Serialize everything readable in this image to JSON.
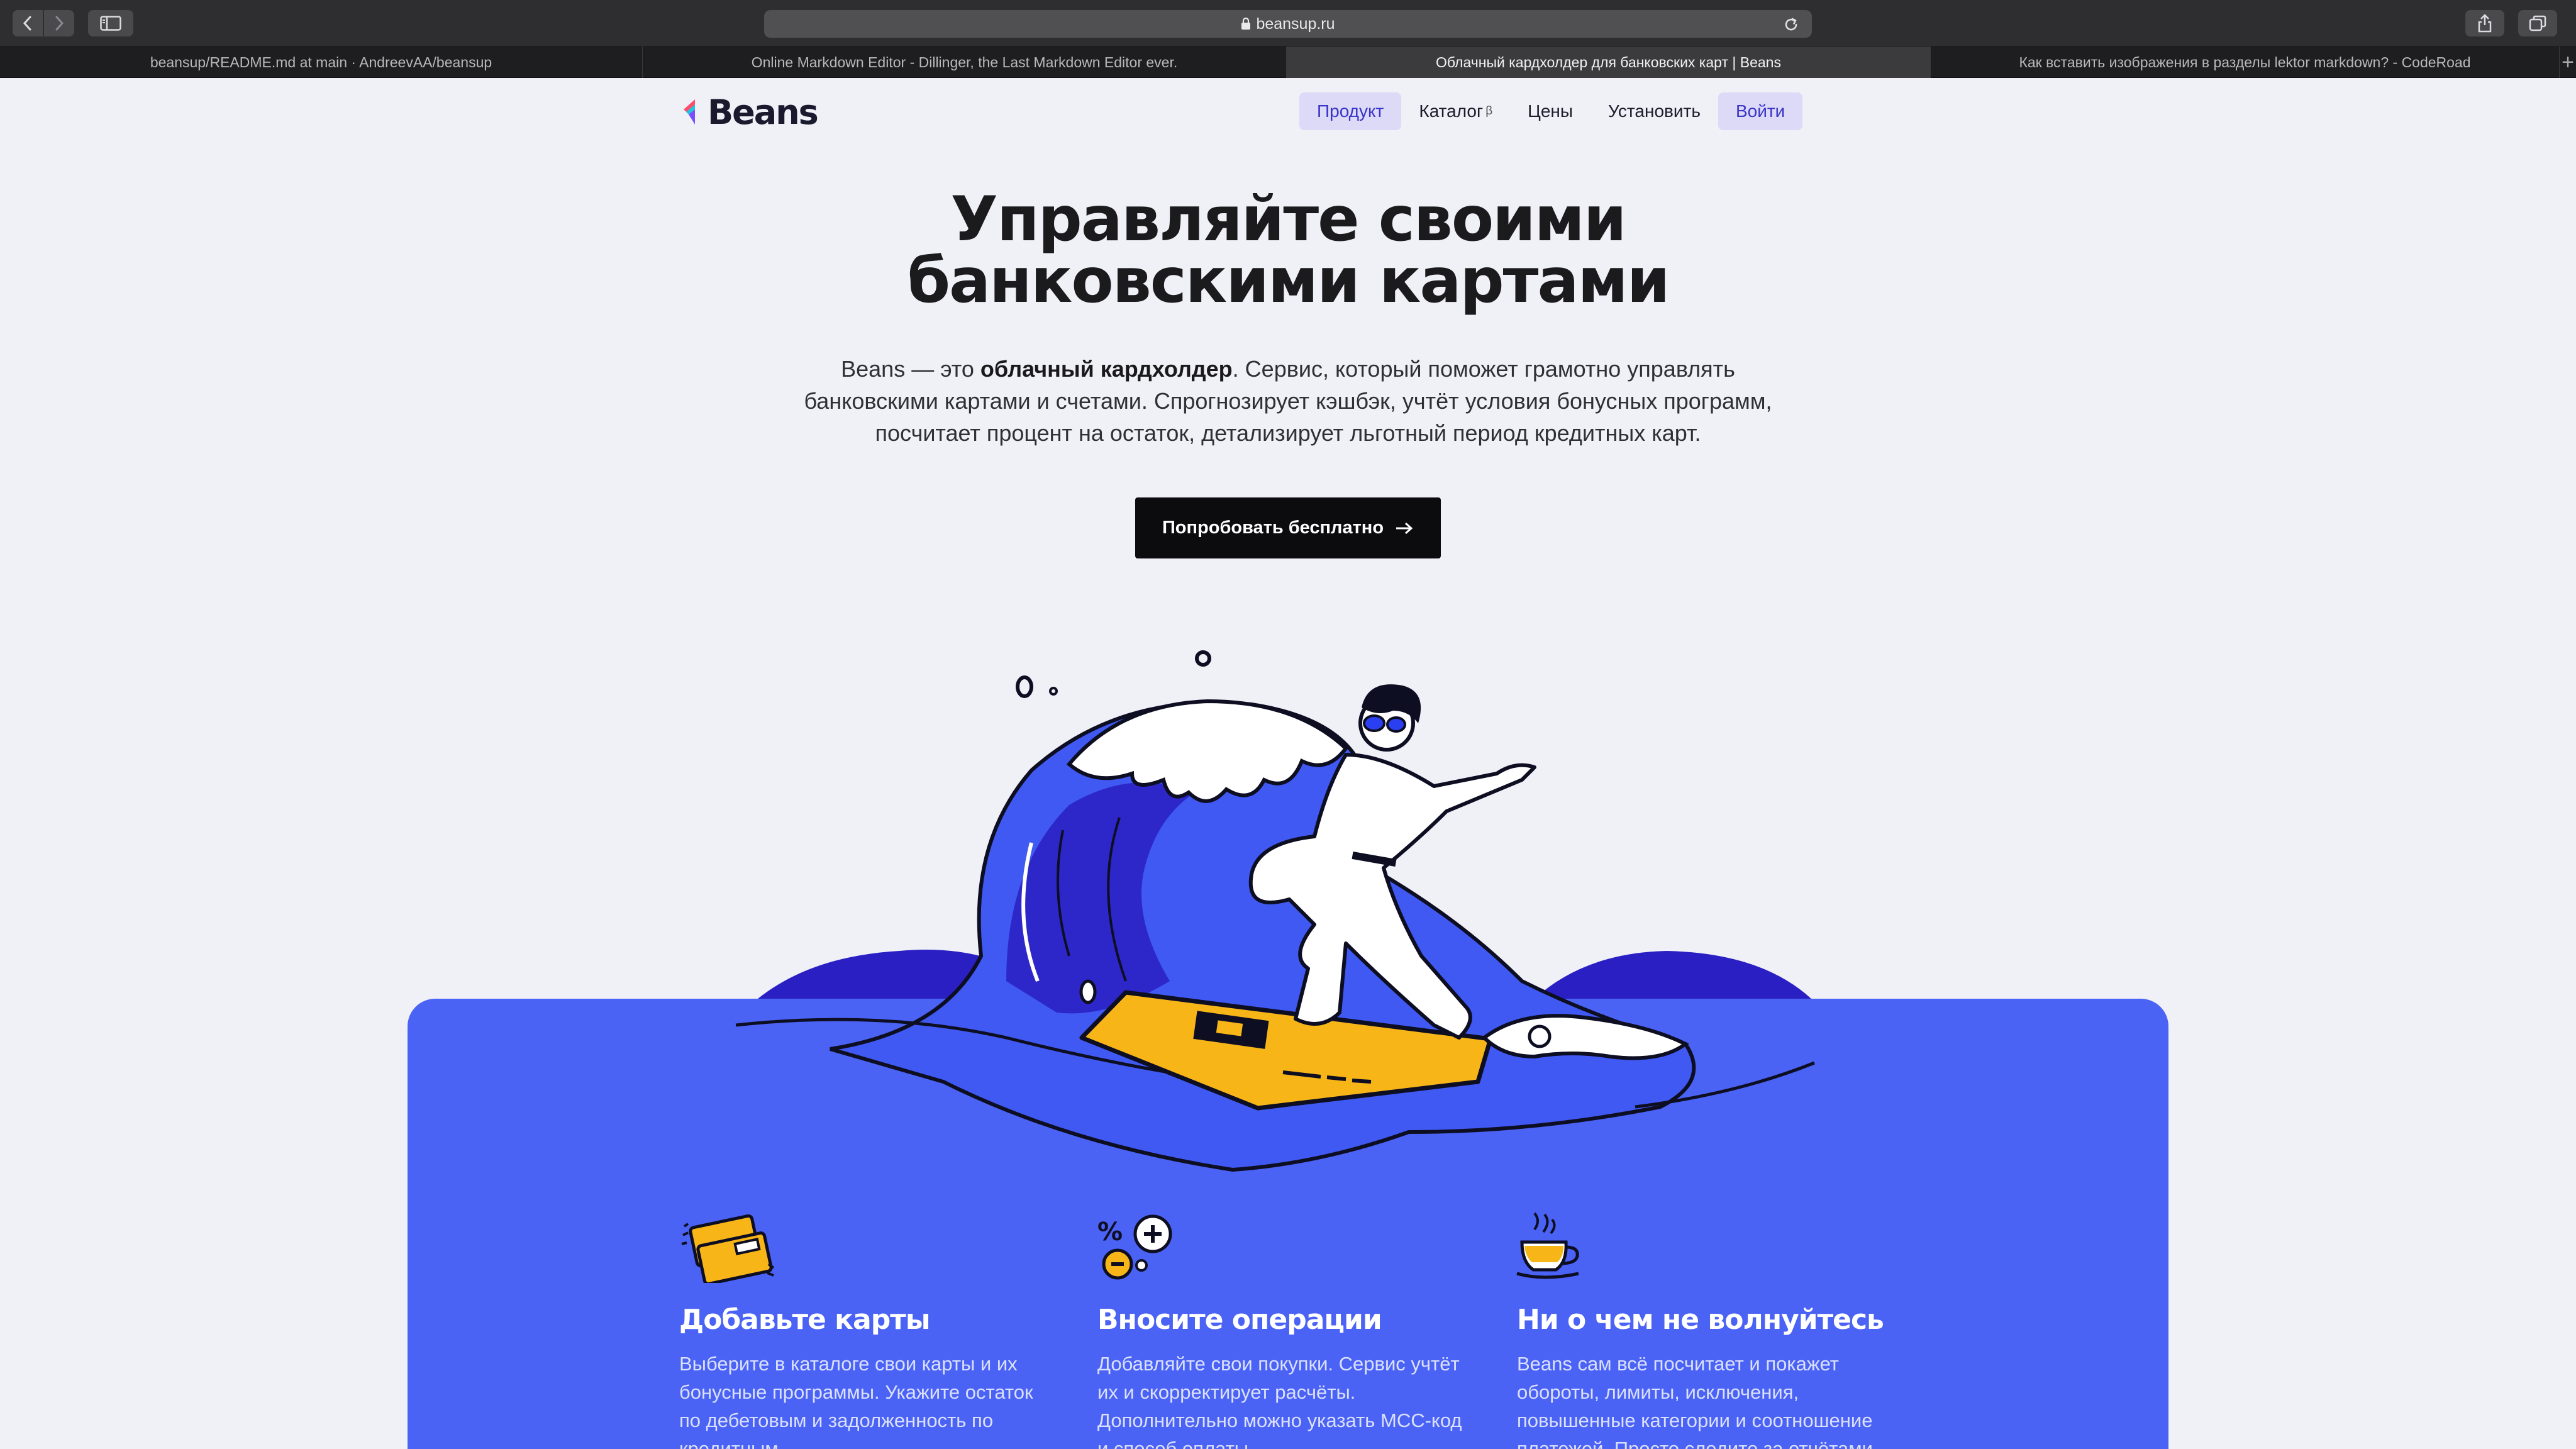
{
  "browser": {
    "url": "beansup.ru",
    "tabs": [
      {
        "title": "beansup/README.md at main · AndreevAA/beansup",
        "active": false
      },
      {
        "title": "Online Markdown Editor - Dillinger, the Last Markdown Editor ever.",
        "active": false
      },
      {
        "title": "Облачный кардхолдер для банковских карт | Beans",
        "active": true
      },
      {
        "title": "Как вставить изображения в разделы lektor markdown? - CodeRoad",
        "active": false
      }
    ]
  },
  "site": {
    "logo": "Beans",
    "nav": {
      "product": "Продукт",
      "catalog": "Каталог",
      "catalog_badge": "β",
      "prices": "Цены",
      "install": "Установить",
      "login": "Войти"
    },
    "hero": {
      "title_line1": "Управляйте своими",
      "title_line2": "банковскими картами",
      "desc_lead": "Beans — это ",
      "desc_bold": "облачный кардхолдер",
      "desc_rest1": ". Сервис, который поможет грамотно управлять",
      "desc_line2": "банковскими картами и счетами. Спрогнозирует кэшбэк, учтёт условия бонусных программ,",
      "desc_line3": "посчитает процент на остаток, детализирует льготный период кредитных карт.",
      "cta": "Попробовать бесплатно"
    },
    "features": [
      {
        "icon": "credit-card-icon",
        "title": "Добавьте карты",
        "text": "Выберите в каталоге свои карты и их бонусные программы. Укажите остаток по дебетовым и задолженность по кредитным."
      },
      {
        "icon": "percent-operations-icon",
        "title": "Вносите операции",
        "text": "Добавляйте свои покупки. Сервис учтёт их и скорректирует расчёты. Дополнительно можно указать MCC-код и способ оплаты."
      },
      {
        "icon": "coffee-cup-icon",
        "title": "Ни о чем не волнуйтесь",
        "text": "Beans сам всё посчитает и покажет обороты, лимиты, исключения, повышенные категории и соотношение платежей. Просто следите за отчётами."
      }
    ]
  },
  "colors": {
    "accent_blue": "#4a63f5",
    "wave_dark": "#2c1fc2",
    "nav_pill_bg": "#dcdaf7",
    "nav_pill_text": "#3b35c8",
    "card_yellow": "#f7b518",
    "page_bg": "#f0f0f7"
  }
}
